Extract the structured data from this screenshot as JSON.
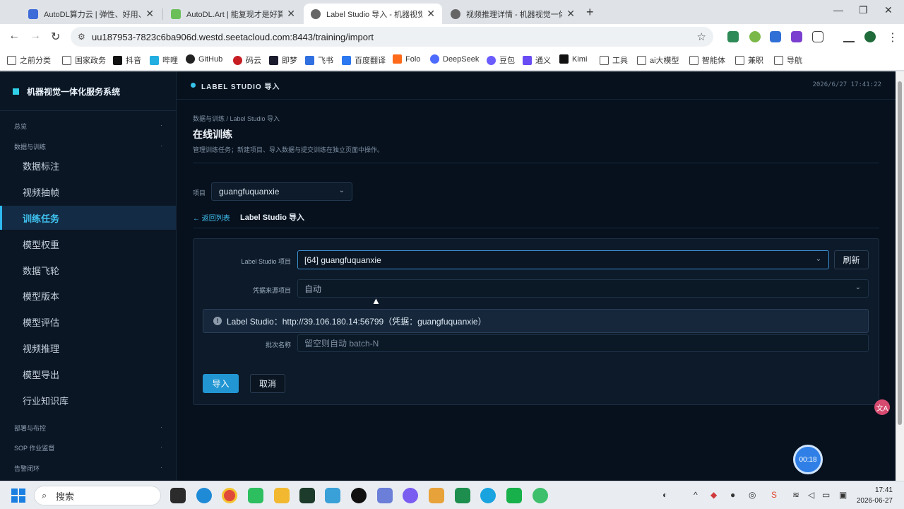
{
  "browser": {
    "tabs": [
      {
        "title": "AutoDL算力云 | 弹性、好用、省",
        "color": "#3d6bd8"
      },
      {
        "title": "AutoDL.Art | 能复现才是好算法",
        "color": "#6bbf59"
      },
      {
        "title": "Label Studio 导入 - 机器视觉一体化",
        "color": "#666666",
        "active": true
      },
      {
        "title": "视频推理详情 - 机器视觉一体化",
        "color": "#666666"
      }
    ],
    "close_glyph": "✕",
    "new_tab_glyph": "+",
    "url": "uu187953-7823c6ba906d.westd.seetacloud.com:8443/training/import",
    "bookmarks": [
      {
        "label": "之前分类",
        "icon": "folder-icon"
      },
      {
        "label": "国家政务",
        "icon": "folder-icon"
      },
      {
        "label": "抖音",
        "icon": "douyin-icon",
        "color": "#111111"
      },
      {
        "label": "哔哩",
        "icon": "bilibili-icon",
        "color": "#22aee0"
      },
      {
        "label": "GitHub",
        "icon": "github-icon",
        "color": "#222222"
      },
      {
        "label": "码云",
        "icon": "gitee-icon",
        "color": "#c71d23"
      },
      {
        "label": "即梦",
        "icon": "jimeng-icon",
        "color": "#1b1b2e"
      },
      {
        "label": "飞书",
        "icon": "feishu-icon",
        "color": "#2f6fe0"
      },
      {
        "label": "百度翻译",
        "icon": "baidu-translate-icon",
        "color": "#2b78f0"
      },
      {
        "label": "Folo",
        "icon": "folo-icon",
        "color": "#ff6a1a"
      },
      {
        "label": "DeepSeek",
        "icon": "deepseek-icon",
        "color": "#4d6bfe"
      },
      {
        "label": "豆包",
        "icon": "doubao-icon",
        "color": "#6a5cff"
      },
      {
        "label": "通义",
        "icon": "tongyi-icon",
        "color": "#6a4cf5"
      },
      {
        "label": "Kimi",
        "icon": "kimi-icon",
        "color": "#111111"
      },
      {
        "label": "工具",
        "icon": "folder-icon"
      },
      {
        "label": "ai大模型",
        "icon": "folder-icon"
      },
      {
        "label": "智能体",
        "icon": "folder-icon"
      },
      {
        "label": "兼职",
        "icon": "folder-icon"
      },
      {
        "label": "导航",
        "icon": "folder-icon"
      }
    ]
  },
  "app": {
    "brand": "机器视觉一体化服务系统",
    "sidebar": {
      "groups": {
        "overview": "总览",
        "data_training": "数据与训练",
        "deploy": "部署与布控",
        "sop": "SOP 作业监督",
        "alarm": "告警闭环"
      },
      "items": [
        "数据标注",
        "视频抽帧",
        "训练任务",
        "模型权重",
        "数据飞轮",
        "模型版本",
        "模型评估",
        "视频推理",
        "模型导出",
        "行业知识库"
      ],
      "active_index": 2
    },
    "topbar": {
      "title": "LABEL STUDIO 导入",
      "datetime": "2026/6/27 17:41:22"
    },
    "page": {
      "breadcrumb": "数据与训练 / Label Studio 导入",
      "title": "在线训练",
      "description": "管理训练任务；新建项目、导入数据与提交训练在独立页面中操作。",
      "project_label": "项目",
      "project_value": "guangfuquanxie",
      "back_link": "← 返回列表",
      "sub_title": "Label Studio 导入"
    },
    "form": {
      "ls_project_label": "Label Studio 项目",
      "ls_project_value": "[64] guangfuquanxie",
      "refresh_label": "刷新",
      "source_label": "凭据来源项目",
      "source_value": "自动",
      "info_text": "Label Studio：http://39.106.180.14:56799（凭据：guangfuquanxie）",
      "batch_label": "批次名称",
      "batch_placeholder": "留空则自动 batch-N",
      "import_label": "导入",
      "cancel_label": "取消"
    },
    "timer": "00:18"
  },
  "taskbar": {
    "search_label": "搜索",
    "time": "17:41",
    "date": "2026-06-27"
  }
}
